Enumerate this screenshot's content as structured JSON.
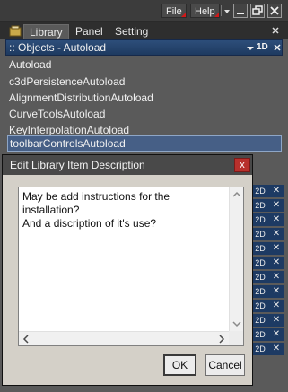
{
  "menubar": {
    "file_label": "File",
    "help_label": "Help",
    "accent_color": "#d01818"
  },
  "tabs": [
    {
      "label": "Library",
      "active": true,
      "icon": "library-icon"
    },
    {
      "label": "Panel",
      "active": false
    },
    {
      "label": "Setting",
      "active": false
    }
  ],
  "panel": {
    "title": ":: Objects - Autoload",
    "mode_label": "1D",
    "header_color": "#1e3a60"
  },
  "library_items": [
    {
      "label": "Autoload",
      "selected": false
    },
    {
      "label": "c3dPersistenceAutoload",
      "selected": false
    },
    {
      "label": "AlignmentDistributionAutoload",
      "selected": false
    },
    {
      "label": "CurveToolsAutoload",
      "selected": false
    },
    {
      "label": "KeyInterpolationAutoload",
      "selected": false
    },
    {
      "label": "toolbarControlsAutoload",
      "selected": true
    }
  ],
  "row_badges": [
    "2D",
    "2D",
    "2D",
    "2D",
    "2D",
    "2D",
    "2D",
    "2D",
    "2D",
    "2D",
    "2D",
    "2D"
  ],
  "row_close_glyph": "✕",
  "dialog": {
    "title": "Edit Library Item Description",
    "close_glyph": "x",
    "close_color": "#b8302c",
    "description": "May be add instructions for the installation?\nAnd a discription of it's use?",
    "ok_label": "OK",
    "cancel_label": "Cancel"
  }
}
